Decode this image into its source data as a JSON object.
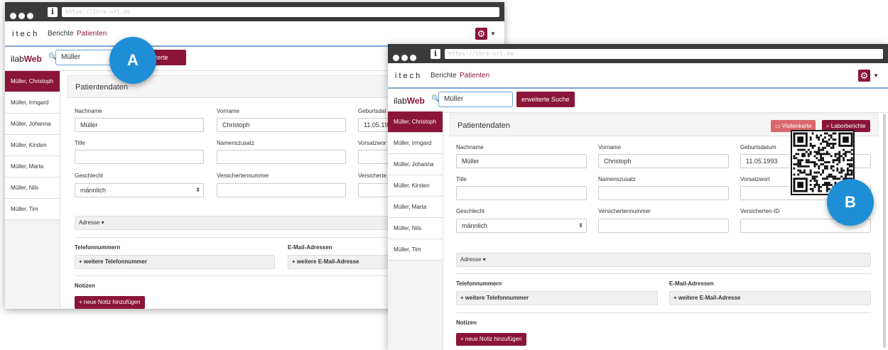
{
  "windows": [
    {
      "id": "A",
      "url": "https://ihre-url.de",
      "brand": "itech",
      "nav": [
        "Berichte",
        "Patienten"
      ],
      "logo_prefix": "ilab",
      "logo_main": "Web",
      "search_value": "Müller",
      "search_button": "erweiterte Suche",
      "badge": "A",
      "patients": [
        "Müller, Christoph",
        "Müller, Irmgard",
        "Müller, Johanna",
        "Müller, Kirsten",
        "Müller, Marta",
        "Müller, Nils",
        "Müller, Tim"
      ],
      "panel_title": "Patientendaten",
      "labels": {
        "nachname": "Nachname",
        "vorname": "Vorname",
        "geburtsdatum": "Geburtsdat",
        "title": "Title",
        "namenszusatz": "Namenszusatz",
        "vorsatzwort": "Vorsatzwor",
        "geschlecht": "Geschlecht",
        "versichertennummer": "Versichertennummer",
        "versicherten_id": "Versicherte"
      },
      "values": {
        "nachname": "Müller",
        "vorname": "Christoph",
        "geburtsdatum": "11.05.199",
        "geschlecht": "männlich"
      },
      "adresse": "Adresse ▾",
      "telefon_title": "Telefonnummern",
      "telefon_add": "+ weitere Telefonnummer",
      "email_title": "E-Mail-Adressen",
      "email_add": "+ weitere E-Mail-Adresse",
      "notizen_title": "Notizen",
      "notiz_add": "+ neue Notiz hinzufügen"
    },
    {
      "id": "B",
      "url": "https://ihre-url.de",
      "brand": "itech",
      "nav": [
        "Berichte",
        "Patienten"
      ],
      "logo_prefix": "ilab",
      "logo_main": "Web",
      "search_value": "Müller",
      "search_button": "erweiterte Suche",
      "badge": "B",
      "patients": [
        "Müller, Christoph",
        "Müller, Irmgard",
        "Müller, Johanna",
        "Müller, Kirsten",
        "Müller, Marta",
        "Müller, Nils",
        "Müller, Tim"
      ],
      "panel_title": "Patientendaten",
      "visitenkarte": "Visitenkarte",
      "laborberichte": "Laborberichte",
      "labels": {
        "nachname": "Nachname",
        "vorname": "Vorname",
        "geburtsdatum": "Geburtsdatum",
        "title": "Title",
        "namenszusatz": "Namenszusatz",
        "vorsatzwort": "Vorsatzwort",
        "geschlecht": "Geschlecht",
        "versichertennummer": "Versichertennummer",
        "versicherten_id": "Versicherten-ID"
      },
      "values": {
        "nachname": "Müller",
        "vorname": "Christoph",
        "geburtsdatum": "11.05.1993",
        "geschlecht": "männlich"
      },
      "adresse": "Adresse ▾",
      "telefon_title": "Telefonnummern",
      "telefon_add": "+ weitere Telefonnummer",
      "email_title": "E-Mail-Adressen",
      "email_add": "+ weitere E-Mail-Adresse",
      "notizen_title": "Notizen",
      "notiz_add": "+ neue Notiz hinzufügen"
    }
  ],
  "colors": {
    "accent": "#8a1538",
    "visitenkarte": "#d9686c",
    "badge": "#1e8fd6",
    "chrome": "#3a3a3a"
  }
}
